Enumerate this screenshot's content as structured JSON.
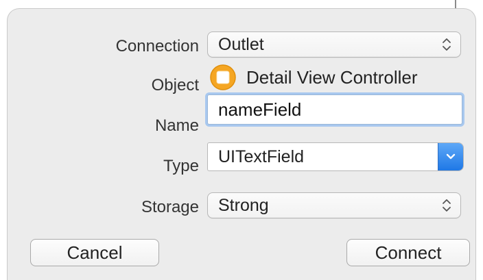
{
  "dialog": {
    "connection": {
      "label": "Connection",
      "value": "Outlet"
    },
    "object": {
      "label": "Object",
      "value": "Detail View Controller",
      "icon": "view-controller-icon",
      "icon_color": "#f5a623"
    },
    "name": {
      "label": "Name",
      "value": "nameField"
    },
    "type": {
      "label": "Type",
      "value": "UITextField",
      "button_color": "#2a82ec"
    },
    "storage": {
      "label": "Storage",
      "value": "Strong"
    },
    "buttons": {
      "cancel": "Cancel",
      "connect": "Connect"
    }
  }
}
